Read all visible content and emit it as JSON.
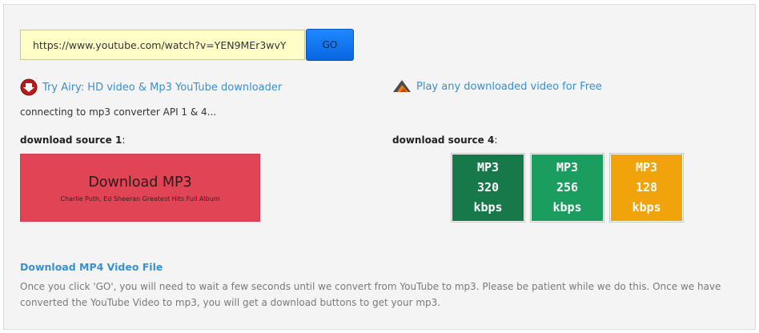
{
  "converter": {
    "url_value": "https://www.youtube.com/watch?v=YEN9MEr3wvY",
    "go_label": "GO"
  },
  "promos": {
    "airy": {
      "text": "Try Airy: HD video & Mp3 YouTube downloader",
      "icon": "airy-download-icon"
    },
    "player": {
      "text": "Play any downloaded video for Free",
      "icon": "video-player-icon"
    }
  },
  "status": "connecting to mp3 converter API 1 & 4...",
  "source1": {
    "heading": "download source 1",
    "suffix": ":",
    "button_label": "Download MP3",
    "button_subtitle": "Charlie Puth, Ed Sheeran Greatest Hits Full Album"
  },
  "source4": {
    "heading": "download source 4",
    "suffix": ":",
    "bitrates": [
      {
        "format": "MP3",
        "value": "320",
        "unit": "kbps",
        "color": "#17794a"
      },
      {
        "format": "MP3",
        "value": "256",
        "unit": "kbps",
        "color": "#1b9d5f"
      },
      {
        "format": "MP3",
        "value": "128",
        "unit": "kbps",
        "color": "#f0a30a"
      }
    ]
  },
  "mp4": {
    "link_label": "Download MP4 Video File",
    "info": "Once you click 'GO', you will need to wait a few seconds until we convert from YouTube to mp3. Please be patient while we do this. Once we have converted the YouTube Video to mp3, you will get a download buttons to get your mp3."
  }
}
